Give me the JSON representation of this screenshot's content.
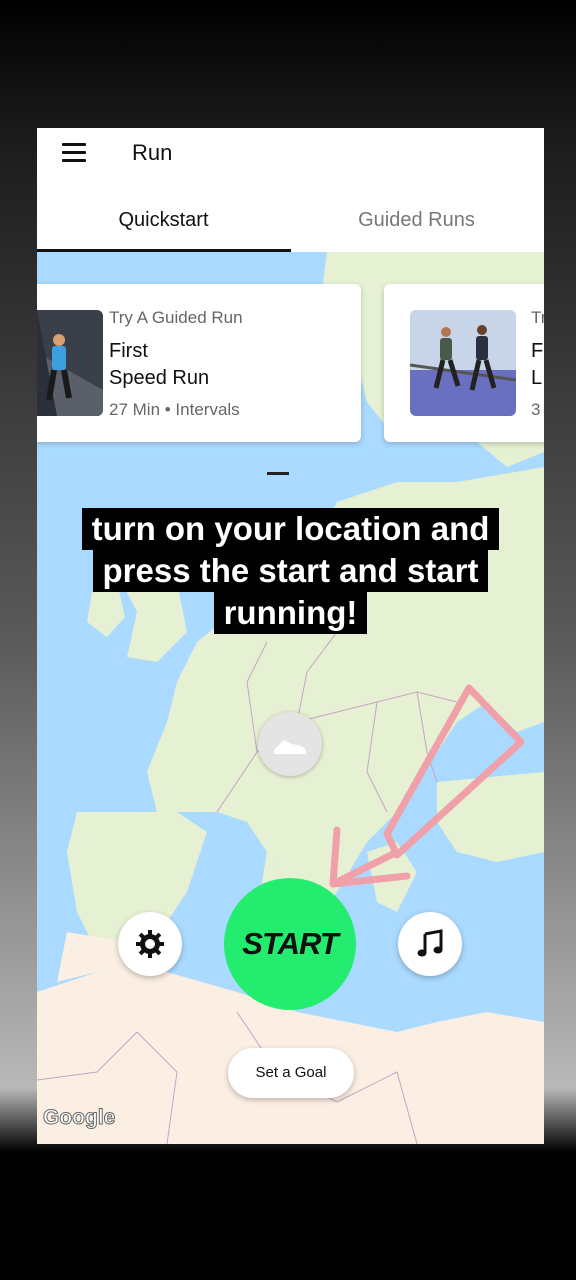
{
  "app": {
    "title": "Run"
  },
  "icons": {
    "menu": "hamburger-menu-icon",
    "settings": "gear-icon",
    "music": "music-note-icon",
    "marker": "shoe-icon"
  },
  "tabs": [
    {
      "label": "Quickstart",
      "active": true
    },
    {
      "label": "Guided Runs",
      "active": false
    }
  ],
  "cards": [
    {
      "kicker": "Try A Guided Run",
      "title_line1": "First",
      "title_line2": "Speed Run",
      "meta": "27 Min • Intervals"
    },
    {
      "kicker": "Tr",
      "title_line1": "F",
      "title_line2": "L",
      "meta": "3"
    }
  ],
  "caption": {
    "line1": "turn on your location and",
    "line2": "press the start and start",
    "line3": "running!"
  },
  "controls": {
    "start_label": "START",
    "goal_label": "Set a Goal"
  },
  "map": {
    "attribution": "Google"
  },
  "colors": {
    "start": "#24ec6e",
    "water": "#aadaff",
    "land": "#e6f0d2",
    "desert": "#fbeee2",
    "arrow": "#f0a0a8"
  }
}
